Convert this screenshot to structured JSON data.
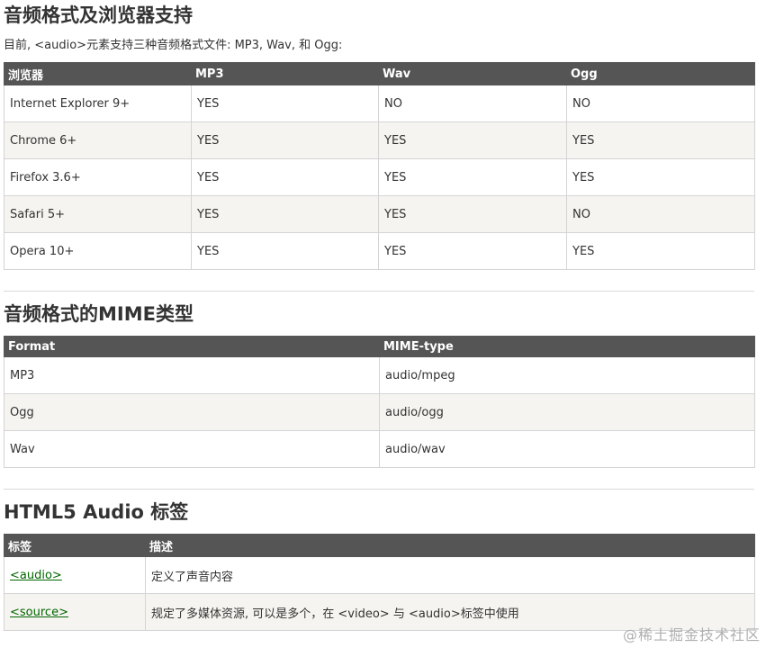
{
  "section1": {
    "title": "音频格式及浏览器支持",
    "intro": "目前, <audio>元素支持三种音频格式文件: MP3, Wav, 和 Ogg:",
    "headers": [
      "浏览器",
      "MP3",
      "Wav",
      "Ogg"
    ],
    "rows": [
      [
        "Internet Explorer 9+",
        "YES",
        "NO",
        "NO"
      ],
      [
        "Chrome 6+",
        "YES",
        "YES",
        "YES"
      ],
      [
        "Firefox 3.6+",
        "YES",
        "YES",
        "YES"
      ],
      [
        "Safari 5+",
        "YES",
        "YES",
        "NO"
      ],
      [
        "Opera 10+",
        "YES",
        "YES",
        "YES"
      ]
    ]
  },
  "section2": {
    "title": "音频格式的MIME类型",
    "headers": [
      "Format",
      "MIME-type"
    ],
    "rows": [
      [
        "MP3",
        "audio/mpeg"
      ],
      [
        "Ogg",
        "audio/ogg"
      ],
      [
        "Wav",
        "audio/wav"
      ]
    ]
  },
  "section3": {
    "title": "HTML5 Audio 标签",
    "headers": [
      "标签",
      "描述"
    ],
    "rows": [
      [
        "<audio>",
        "定义了声音内容"
      ],
      [
        "<source>",
        "规定了多媒体资源, 可以是多个，在 <video> 与 <audio>标签中使用"
      ]
    ]
  },
  "watermark": "@稀土掘金技术社区",
  "colors": {
    "header_bg": "#555555",
    "row_alt_bg": "#f6f4f0",
    "link": "#006600",
    "border": "#d4d4d4"
  }
}
